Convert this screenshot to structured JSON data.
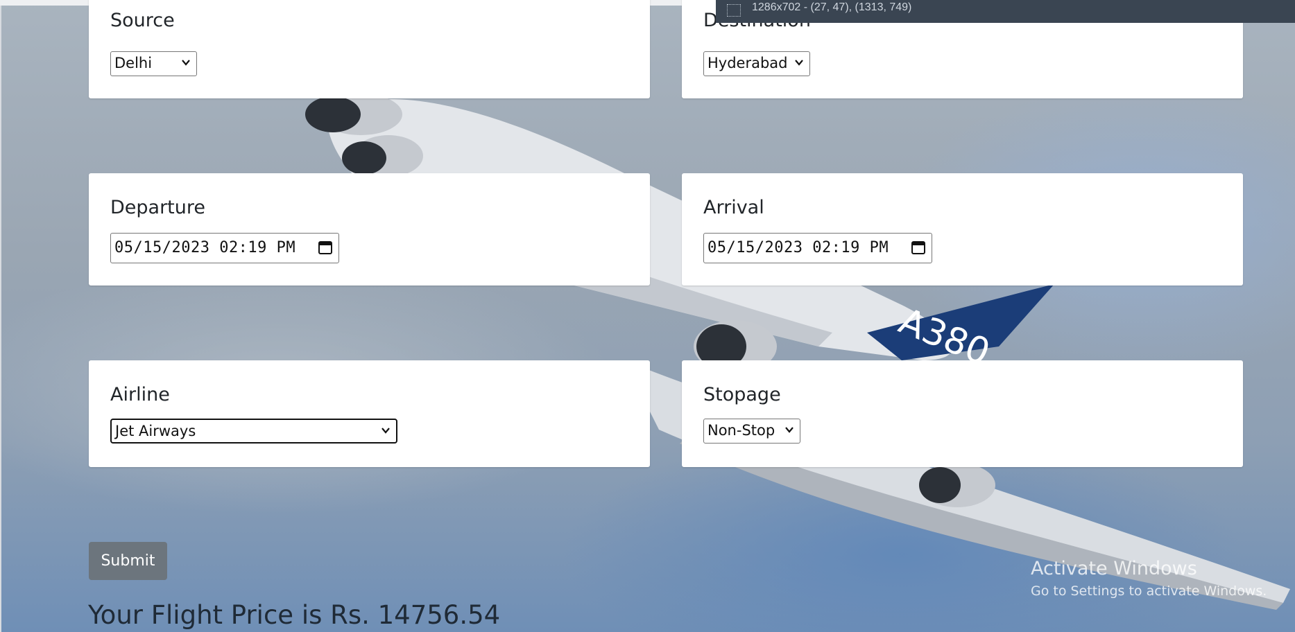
{
  "overlay": {
    "selection_info": "1286x702 - (27, 47), (1313, 749)"
  },
  "form": {
    "source": {
      "label": "Source",
      "value": "Delhi"
    },
    "destination": {
      "label": "Destination",
      "value": "Hyderabad"
    },
    "departure": {
      "label": "Departure",
      "value": "05/15/2023 02:19 PM"
    },
    "arrival": {
      "label": "Arrival",
      "value": "05/15/2023 02:19 PM"
    },
    "airline": {
      "label": "Airline",
      "value": "Jet Airways"
    },
    "stopage": {
      "label": "Stopage",
      "value": "Non-Stop"
    },
    "submit_label": "Submit"
  },
  "result": {
    "text": "Your Flight Price is Rs. 14756.54"
  },
  "watermark": {
    "title": "Activate Windows",
    "subtitle": "Go to Settings to activate Windows."
  },
  "background": {
    "aircraft_marking": "A380"
  }
}
